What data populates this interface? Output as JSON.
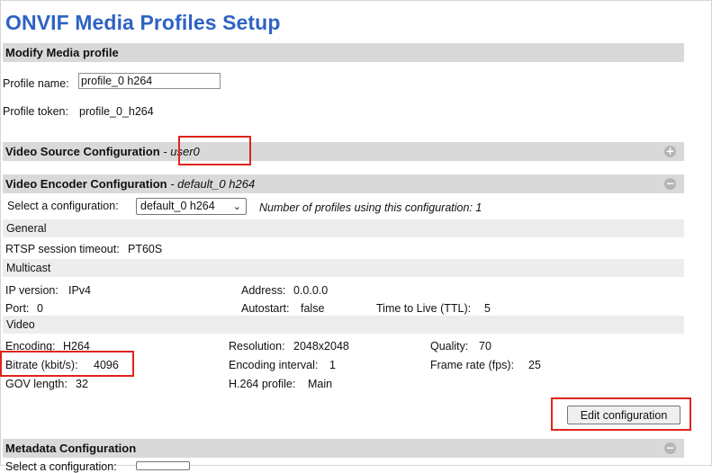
{
  "page": {
    "title": "ONVIF Media Profiles Setup"
  },
  "modify": {
    "header": "Modify Media profile",
    "name_label": "Profile name:",
    "name_value": "profile_0 h264",
    "token_label": "Profile token:",
    "token_value": "profile_0_h264"
  },
  "video_source": {
    "header": "Video Source Configuration",
    "separator": "-",
    "sub": "user0",
    "toggle": "+"
  },
  "video_encoder": {
    "header": "Video Encoder Configuration",
    "sub": "- default_0 h264",
    "toggle": "−",
    "select_label": "Select a configuration:",
    "select_value": "default_0 h264",
    "profiles_using": "Number of profiles using this configuration: 1",
    "general": {
      "heading": "General",
      "rtsp_label": "RTSP session timeout:",
      "rtsp_value": "PT60S"
    },
    "multicast": {
      "heading": "Multicast",
      "ip_label": "IP version:",
      "ip_value": "IPv4",
      "address_label": "Address:",
      "address_value": "0.0.0.0",
      "port_label": "Port:",
      "port_value": "0",
      "autostart_label": "Autostart:",
      "autostart_value": "false",
      "ttl_label": "Time to Live (TTL):",
      "ttl_value": "5"
    },
    "video": {
      "heading": "Video",
      "encoding_label": "Encoding:",
      "encoding_value": "H264",
      "resolution_label": "Resolution:",
      "resolution_value": "2048x2048",
      "quality_label": "Quality:",
      "quality_value": "70",
      "bitrate_label": "Bitrate (kbit/s):",
      "bitrate_value": "4096",
      "interval_label": "Encoding interval:",
      "interval_value": "1",
      "framerate_label": "Frame rate (fps):",
      "framerate_value": "25",
      "gov_label": "GOV length:",
      "gov_value": "32",
      "profile_label": "H.264 profile:",
      "profile_value": "Main"
    },
    "edit_button": "Edit configuration"
  },
  "metadata": {
    "header": "Metadata Configuration",
    "toggle": "−",
    "select_label": "Select a configuration:"
  },
  "colors": {
    "title": "#2e63c4",
    "highlight": "#e0241b",
    "section_bg": "#d9d9d9",
    "subhead_bg": "#ededed"
  }
}
